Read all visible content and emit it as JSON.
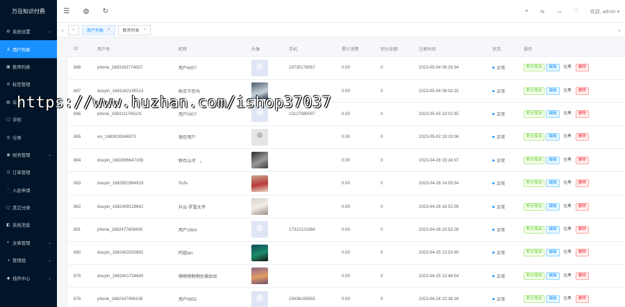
{
  "app": {
    "title": "万岳知识付费"
  },
  "sidebar": {
    "items": [
      {
        "icon": "⚙",
        "label": "系统设置",
        "arrow": "⌄"
      },
      {
        "icon": "♙",
        "label": "用户列表",
        "arrow": ""
      },
      {
        "icon": "▣",
        "label": "教师列表",
        "arrow": ""
      },
      {
        "icon": "⊘",
        "label": "标签管理",
        "arrow": ""
      },
      {
        "icon": "▤",
        "label": "年级",
        "arrow": ""
      },
      {
        "icon": "▢",
        "label": "学校",
        "arrow": ""
      },
      {
        "icon": "◎",
        "label": "分类",
        "arrow": ""
      },
      {
        "icon": "◉",
        "label": "财务管理",
        "arrow": "⌄"
      },
      {
        "icon": "◷",
        "label": "订单管理",
        "arrow": ""
      },
      {
        "icon": "◌",
        "label": "入驻申请",
        "arrow": ""
      },
      {
        "icon": "▢",
        "label": "其它分类",
        "arrow": ""
      },
      {
        "icon": "◧",
        "label": "系统消息",
        "arrow": ""
      },
      {
        "icon": "◐",
        "label": "文章管理",
        "arrow": "⌄"
      },
      {
        "icon": "◑",
        "label": "管理组",
        "arrow": "⌄"
      },
      {
        "icon": "◆",
        "label": "插件中心",
        "arrow": "⌄"
      }
    ]
  },
  "topbar": {
    "icons": [
      "☰",
      "◍",
      "↻"
    ],
    "right_icons": [
      "≡",
      "⇆",
      "▭",
      "⛶"
    ],
    "user": "欢迎, admin ▾"
  },
  "tabs": [
    {
      "label": "用户列表",
      "close": "×"
    },
    {
      "label": "教师列表",
      "close": "×"
    }
  ],
  "tabs_icons": {
    "left": "‹",
    "home": "⌂",
    "right": "›"
  },
  "table": {
    "columns": [
      "ID",
      "用户名",
      "昵称",
      "头像",
      "手机",
      "累计消费",
      "积分余额",
      "注册时间",
      "状态",
      "操作"
    ],
    "actions": {
      "points": "积分变动",
      "edit": "编辑",
      "block": "拉黑",
      "delete": "删除"
    },
    "rows": [
      {
        "id": "888",
        "username": "phone_1683163774657",
        "nickname": "用户6057",
        "avatar": "default",
        "phone": "18735178057",
        "spent": "0.00",
        "points": "0",
        "registered": "2023-05-04 09:29:34",
        "status": "正常",
        "block": "拉黑"
      },
      {
        "id": "887",
        "username": "douyin_1683162195513",
        "nickname": "鲜衣不怒马",
        "avatar": "photo1",
        "phone": "",
        "spent": "0.00",
        "points": "0",
        "registered": "2023-05-04 09:03:15",
        "status": "正常",
        "block": "拉黑"
      },
      {
        "id": "886",
        "username": "phone_1683111765101",
        "nickname": "用户0007",
        "avatar": "default",
        "phone": "13127880007",
        "spent": "0.00",
        "points": "0",
        "registered": "2023-05-03 19:02:45",
        "status": "正常",
        "block": "拉黑"
      },
      {
        "id": "885",
        "username": "wx_1683026346973",
        "nickname": "微信用户",
        "avatar": "gray",
        "phone": "",
        "spent": "0.00",
        "points": "0",
        "registered": "2023-05-02 19:19:06",
        "status": "正常",
        "block": "拉黑"
      },
      {
        "id": "884",
        "username": "douyin_1682666647156",
        "nickname": "野月山河　。",
        "avatar": "photo2",
        "phone": "",
        "spent": "0.00",
        "points": "0",
        "registered": "2023-04-28 15:24:07",
        "status": "正常",
        "block": "拉黑"
      },
      {
        "id": "883",
        "username": "douyin_1682651964919",
        "nickname": "SuN-",
        "avatar": "photo3",
        "phone": "",
        "spent": "0.00",
        "points": "0",
        "registered": "2023-04-28 14:05:54",
        "status": "正常",
        "block": "拉黑"
      },
      {
        "id": "882",
        "username": "douyin_1682499129642",
        "nickname": "抖云-罗雷太爷",
        "avatar": "photo4",
        "phone": "",
        "spent": "0.00",
        "points": "0",
        "registered": "2023-04-26 16:52:09",
        "status": "正常",
        "block": "拉黑"
      },
      {
        "id": "881",
        "username": "phone_1682477608430",
        "nickname": "用户1964",
        "avatar": "default",
        "phone": "17312121964",
        "spent": "0.00",
        "points": "0",
        "registered": "2023-04-26 10:53:28",
        "status": "正常",
        "block": "拉黑"
      },
      {
        "id": "880",
        "username": "douyin_1682402020891",
        "nickname": "阿姐lan",
        "avatar": "photo5",
        "phone": "",
        "spent": "0.00",
        "points": "0",
        "registered": "2023-04-25 13:53:40",
        "status": "正常",
        "block": "拉黑"
      },
      {
        "id": "879",
        "username": "douyin_1682401734685",
        "nickname": "啊啊啊啊啊优雅脸线",
        "avatar": "photo6",
        "phone": "",
        "spent": "0.00",
        "points": "0",
        "registered": "2023-04-25 13:48:54",
        "status": "正常",
        "block": "拉黑"
      },
      {
        "id": "878",
        "username": "phone_1682347096108",
        "nickname": "用户9955",
        "avatar": "default",
        "phone": "15036159955",
        "spent": "0.00",
        "points": "0",
        "registered": "2023-04-24 22:38:16",
        "status": "正常",
        "block": "拉黑"
      }
    ]
  },
  "watermark": "https://www.huzhan.com/ishop37037"
}
